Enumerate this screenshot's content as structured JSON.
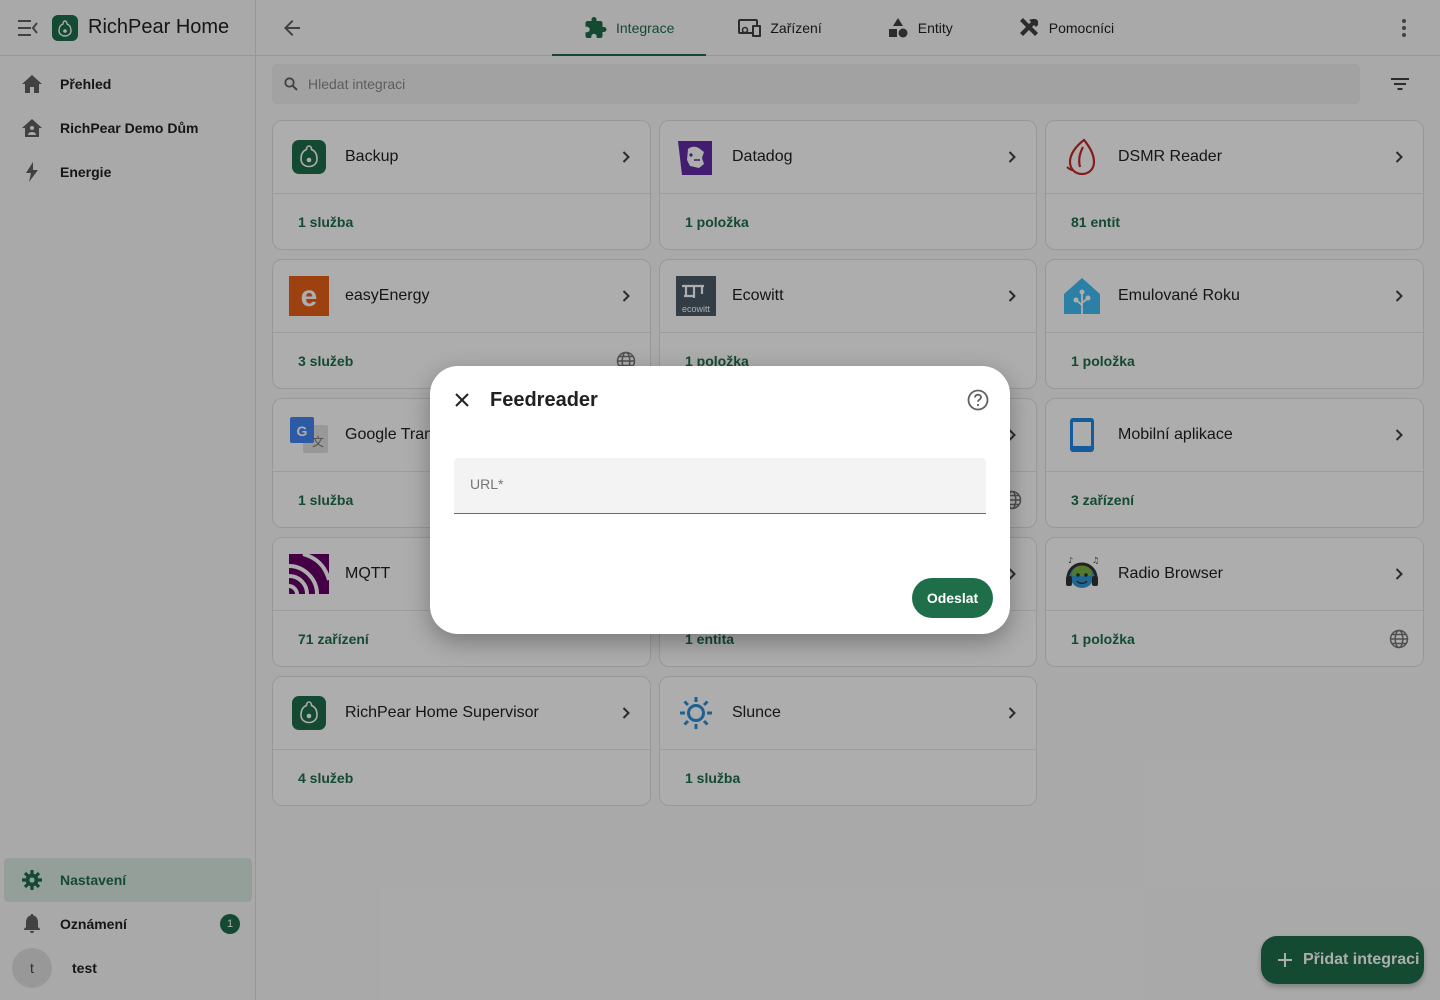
{
  "app": {
    "title": "RichPear Home"
  },
  "sidebar": {
    "items": [
      {
        "label": "Přehled",
        "icon": "home-icon"
      },
      {
        "label": "RichPear Demo Dům",
        "icon": "home-account-icon"
      },
      {
        "label": "Energie",
        "icon": "lightning-icon"
      }
    ],
    "bottom": {
      "settings_label": "Nastavení",
      "notifications_label": "Oznámení",
      "notifications_count": "1",
      "user_initial": "t",
      "user_name": "test"
    }
  },
  "topbar": {
    "tabs": [
      {
        "label": "Integrace",
        "icon": "puzzle-icon",
        "active": true
      },
      {
        "label": "Zařízení",
        "icon": "devices-icon",
        "active": false
      },
      {
        "label": "Entity",
        "icon": "shapes-icon",
        "active": false
      },
      {
        "label": "Pomocníci",
        "icon": "tools-icon",
        "active": false
      }
    ]
  },
  "search": {
    "placeholder": "Hledat integraci"
  },
  "integrations": [
    {
      "name": "Backup",
      "link": "1 služba",
      "logo": "richpear-logo",
      "globe": false
    },
    {
      "name": "Datadog",
      "link": "1 položka",
      "logo": "datadog-logo",
      "globe": false
    },
    {
      "name": "DSMR Reader",
      "link": "81 entit",
      "logo": "dsmr-logo",
      "globe": false
    },
    {
      "name": "easyEnergy",
      "link": "3 služeb",
      "logo": "easyenergy-logo",
      "globe": true
    },
    {
      "name": "Ecowitt",
      "link": "1 položka",
      "logo": "ecowitt-logo",
      "globe": false
    },
    {
      "name": "Emulované Roku",
      "link": "1 položka",
      "logo": "roku-logo",
      "globe": false
    },
    {
      "name": "Google Translate",
      "link": "1 služba",
      "logo": "google-translate-logo",
      "globe": false
    },
    {
      "name": "",
      "link": "",
      "logo": "",
      "globe": true
    },
    {
      "name": "Mobilní aplikace",
      "link": "3 zařízení",
      "logo": "mobile-app-logo",
      "globe": false
    },
    {
      "name": "MQTT",
      "link": "71 zařízení",
      "logo": "mqtt-logo",
      "globe": false
    },
    {
      "name": "",
      "link": "1 entita",
      "logo": "",
      "globe": false
    },
    {
      "name": "Radio Browser",
      "link": "1 položka",
      "logo": "radio-browser-logo",
      "globe": true
    },
    {
      "name": "RichPear Home Supervisor",
      "link": "4 služeb",
      "logo": "richpear-logo",
      "globe": false
    },
    {
      "name": "Slunce",
      "link": "1 služba",
      "logo": "sun-logo",
      "globe": false
    }
  ],
  "fab": {
    "label": "Přidat integraci"
  },
  "dialog": {
    "title": "Feedreader",
    "field_label": "URL*",
    "submit_label": "Odeslat"
  },
  "colors": {
    "accent": "#1e6e4a",
    "scrim": "rgba(0,0,0,0.32)"
  }
}
